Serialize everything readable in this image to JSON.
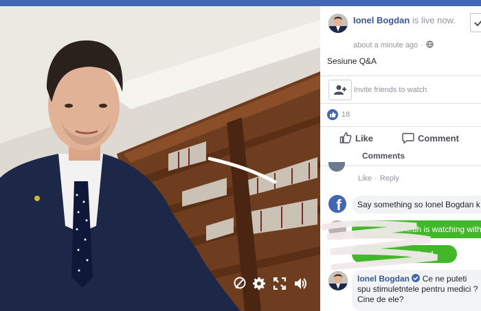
{
  "colors": {
    "facebook_blue": "#4267b2",
    "link": "#365899",
    "green": "#42b72a",
    "gray_text": "#90949c"
  },
  "post": {
    "author": "Ionel Bogdan",
    "status_text": "is live now.",
    "time": "about a minute ago",
    "privacy_icon": "globe-icon",
    "description": "Sesiune Q&A"
  },
  "invite": {
    "placeholder": "Invite friends to watch",
    "icon": "add-friend-icon"
  },
  "reactions": {
    "count": "18",
    "icon": "like-icon"
  },
  "actions": {
    "like": "Like",
    "comment": "Comment"
  },
  "comments_tab": "Comments",
  "first_comment_actions": {
    "like": "Like",
    "dot": "·",
    "reply": "Reply"
  },
  "feed": {
    "prompt": "Say something so Ionel Bogdan k",
    "green_1": "...uh is watching with yo",
    "green_2": "...ined"
  },
  "comment": {
    "author": "Ionel Bogdan",
    "verified_icon": "verified-check-icon",
    "text": "Ce ne puteti spu stimuletntele pentru medici ? Cine de ele?"
  },
  "video_controls": [
    "comment-off-icon",
    "gear-icon",
    "fullscreen-icon",
    "volume-icon"
  ]
}
